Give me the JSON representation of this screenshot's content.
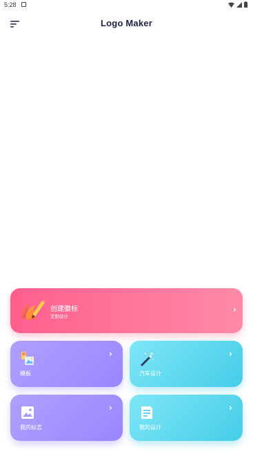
{
  "status": {
    "time": "5:28"
  },
  "app": {
    "title": "Logo Maker"
  },
  "cards": {
    "create": {
      "title": "创建徽标",
      "subtitle": "定制设计",
      "chevron": "›"
    },
    "templates": {
      "label": "模板",
      "chevron": "›"
    },
    "car": {
      "label": "汽车设计",
      "chevron": "›"
    },
    "mylogos": {
      "label": "我的标志",
      "chevron": "›"
    },
    "mydesigns": {
      "label": "我的设计",
      "chevron": "›"
    }
  },
  "icons": {
    "menu": "menu-icon",
    "create": "brush-icon",
    "templates": "template-icon",
    "car": "magic-wand-icon",
    "mylogos": "image-icon",
    "mydesigns": "document-icon"
  }
}
